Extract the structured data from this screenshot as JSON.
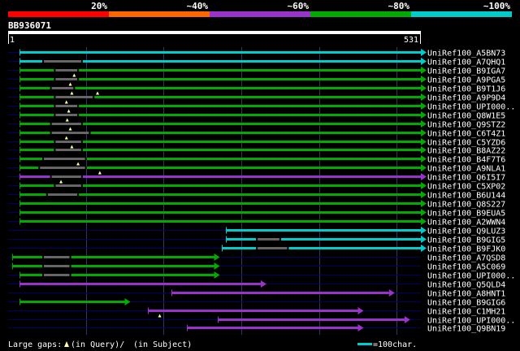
{
  "colors": {
    "background": "#000000",
    "text": "#ffffff",
    "grid": "#333366",
    "track": "#000066",
    "gap": "#666666",
    "query_bar": "#ffffff"
  },
  "identity_legend": [
    {
      "label": "20%",
      "color": "#ff0000"
    },
    {
      "label": "~40%",
      "color": "#ff6600"
    },
    {
      "label": "~60%",
      "color": "#9933cc"
    },
    {
      "label": "~80%",
      "color": "#00aa00"
    },
    {
      "label": "~100%",
      "color": "#00cccc"
    }
  ],
  "query": {
    "name": "BB936071",
    "start_label": "1",
    "end_label": "531",
    "length": 531
  },
  "hits": [
    {
      "id": "UniRef100_A5BN73",
      "start": 15,
      "end": 531,
      "level": 4,
      "gaps": [],
      "insert_marks": []
    },
    {
      "id": "UniRef100_A7QHQ1",
      "start": 15,
      "end": 531,
      "level": 4,
      "gaps": [
        [
          45,
          95
        ]
      ],
      "insert_marks": []
    },
    {
      "id": "UniRef100_B9IGA7",
      "start": 15,
      "end": 531,
      "level": 3,
      "gaps": [
        [
          60,
          90
        ]
      ],
      "insert_marks": [
        85
      ]
    },
    {
      "id": "UniRef100_A9PGA5",
      "start": 15,
      "end": 531,
      "level": 3,
      "gaps": [
        [
          60,
          90
        ]
      ],
      "insert_marks": [
        80
      ]
    },
    {
      "id": "UniRef100_B9T1J6",
      "start": 15,
      "end": 531,
      "level": 3,
      "gaps": [
        [
          55,
          85
        ]
      ],
      "insert_marks": [
        82,
        115
      ]
    },
    {
      "id": "UniRef100_A9P9D4",
      "start": 15,
      "end": 531,
      "level": 3,
      "gaps": [
        [
          60,
          110
        ]
      ],
      "insert_marks": [
        75
      ]
    },
    {
      "id": "UniRef100_UPI000..",
      "start": 15,
      "end": 531,
      "level": 3,
      "gaps": [
        [
          60,
          90
        ]
      ],
      "insert_marks": [
        78
      ]
    },
    {
      "id": "UniRef100_Q8W1E5",
      "start": 15,
      "end": 531,
      "level": 3,
      "gaps": [
        [
          60,
          90
        ]
      ],
      "insert_marks": [
        76
      ]
    },
    {
      "id": "UniRef100_Q9STZ2",
      "start": 15,
      "end": 531,
      "level": 3,
      "gaps": [
        [
          55,
          95
        ]
      ],
      "insert_marks": [
        80
      ]
    },
    {
      "id": "UniRef100_C6T4Z1",
      "start": 15,
      "end": 531,
      "level": 3,
      "gaps": [
        [
          55,
          105
        ]
      ],
      "insert_marks": [
        75
      ]
    },
    {
      "id": "UniRef100_C5YZD6",
      "start": 15,
      "end": 531,
      "level": 3,
      "gaps": [
        [
          60,
          95
        ]
      ],
      "insert_marks": [
        82
      ]
    },
    {
      "id": "UniRef100_B8AZ22",
      "start": 15,
      "end": 531,
      "level": 3,
      "gaps": [
        [
          60,
          95
        ]
      ],
      "insert_marks": []
    },
    {
      "id": "UniRef100_B4F7T6",
      "start": 15,
      "end": 531,
      "level": 3,
      "gaps": [
        [
          45,
          100
        ]
      ],
      "insert_marks": [
        90
      ]
    },
    {
      "id": "UniRef100_A9NLA1",
      "start": 15,
      "end": 531,
      "level": 3,
      "gaps": [
        [
          40,
          100
        ]
      ],
      "insert_marks": [
        118
      ]
    },
    {
      "id": "UniRef100_Q6I5I7",
      "start": 15,
      "end": 531,
      "level": 2,
      "gaps": [
        [
          55,
          95
        ]
      ],
      "insert_marks": [
        68
      ]
    },
    {
      "id": "UniRef100_C5XP02",
      "start": 15,
      "end": 531,
      "level": 3,
      "gaps": [
        [
          60,
          95
        ]
      ],
      "insert_marks": []
    },
    {
      "id": "UniRef100_B6U144",
      "start": 15,
      "end": 531,
      "level": 3,
      "gaps": [
        [
          50,
          90
        ]
      ],
      "insert_marks": []
    },
    {
      "id": "UniRef100_Q8S227",
      "start": 15,
      "end": 531,
      "level": 3,
      "gaps": [],
      "insert_marks": []
    },
    {
      "id": "UniRef100_B9EUA5",
      "start": 15,
      "end": 531,
      "level": 3,
      "gaps": [],
      "insert_marks": []
    },
    {
      "id": "UniRef100_A2WWN4",
      "start": 15,
      "end": 531,
      "level": 3,
      "gaps": [],
      "insert_marks": []
    },
    {
      "id": "UniRef100_Q9LUZ3",
      "start": 280,
      "end": 531,
      "level": 4,
      "gaps": [],
      "insert_marks": []
    },
    {
      "id": "UniRef100_B9GIG5",
      "start": 280,
      "end": 531,
      "level": 4,
      "gaps": [
        [
          320,
          350
        ]
      ],
      "insert_marks": []
    },
    {
      "id": "UniRef100_B9FJK0",
      "start": 275,
      "end": 531,
      "level": 4,
      "gaps": [
        [
          320,
          360
        ]
      ],
      "insert_marks": []
    },
    {
      "id": "UniRef100_A7QSD8",
      "start": 5,
      "end": 265,
      "level": 3,
      "gaps": [
        [
          45,
          80
        ]
      ],
      "insert_marks": []
    },
    {
      "id": "UniRef100_A5C069",
      "start": 5,
      "end": 265,
      "level": 3,
      "gaps": [
        [
          45,
          80
        ]
      ],
      "insert_marks": []
    },
    {
      "id": "UniRef100_UPI000..",
      "start": 15,
      "end": 265,
      "level": 3,
      "gaps": [
        [
          45,
          80
        ]
      ],
      "insert_marks": []
    },
    {
      "id": "UniRef100_Q5QLD4",
      "start": 15,
      "end": 325,
      "level": 2,
      "gaps": [],
      "insert_marks": []
    },
    {
      "id": "UniRef100_A8HNT1",
      "start": 210,
      "end": 490,
      "level": 2,
      "gaps": [],
      "insert_marks": []
    },
    {
      "id": "UniRef100_B9GIG6",
      "start": 15,
      "end": 150,
      "level": 3,
      "gaps": [],
      "insert_marks": []
    },
    {
      "id": "UniRef100_C1MH21",
      "start": 180,
      "end": 450,
      "level": 2,
      "gaps": [],
      "insert_marks": [
        195
      ]
    },
    {
      "id": "UniRef100_UPI000..",
      "start": 270,
      "end": 510,
      "level": 2,
      "gaps": [],
      "insert_marks": []
    },
    {
      "id": "UniRef100_Q9BN19",
      "start": 230,
      "end": 450,
      "level": 2,
      "gaps": [],
      "insert_marks": []
    }
  ],
  "footer": {
    "gaps_prefix": "Large gaps:",
    "gaps_query": "(in Query)/",
    "gaps_subject": "(in Subject)",
    "scale_label": "=100char."
  }
}
